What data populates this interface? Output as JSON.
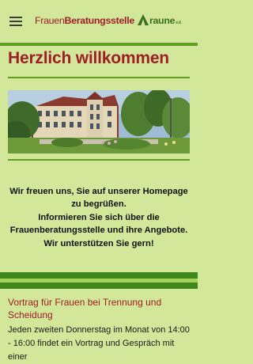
{
  "header": {
    "menu_icon": "hamburger-menu-icon",
    "logo": {
      "part1": "Frauen",
      "part2": "Beratungsstelle",
      "part3": "raune",
      "suffix": "e.V."
    }
  },
  "main": {
    "title": "Herzlich willkommen",
    "photo_icon": "building-photo",
    "welcome_lines": [
      "Wir freuen uns, Sie auf unserer Homepage zu begrüßen.",
      "Informieren Sie sich über die Frauenberatungsstelle und ihre Angebote.",
      "Wir unterstützen Sie gern!"
    ]
  },
  "news": {
    "title": "Vortrag für Frauen bei Trennung und Scheidung",
    "text": "Jeden zweiten Donnerstag im Monat von 14:00 - 16:00 findet ein Vortrag und Gespräch mit einer"
  },
  "colors": {
    "background": "#d2e79a",
    "brand_red": "#9e1f28",
    "brand_green": "#3b6e1e",
    "accent_green": "#5fa020"
  }
}
